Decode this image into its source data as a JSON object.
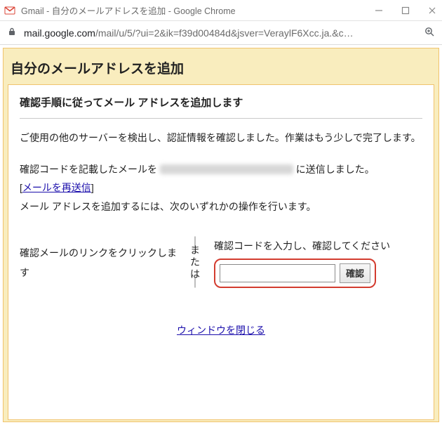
{
  "window": {
    "title": "Gmail - 自分のメールアドレスを追加 - Google Chrome"
  },
  "address": {
    "host": "mail.google.com",
    "path": "/mail/u/5/?ui=2&ik=f39d00484d&jsver=VeraylF6Xcc.ja.&c…"
  },
  "page": {
    "title": "自分のメールアドレスを追加",
    "heading": "確認手順に従ってメール アドレスを追加します",
    "para1": "ご使用の他のサーバーを検出し、認証情報を確認しました。作業はもう少しで完了します。",
    "sent_prefix": "確認コードを記載したメールを ",
    "sent_suffix": " に送信しました。",
    "resend_open": "[",
    "resend_label": "メールを再送信",
    "resend_close": "]",
    "instruction": "メール アドレスを追加するには、次のいずれかの操作を行います。",
    "left_option": "確認メールのリンクをクリックします",
    "or_bar": "｜",
    "or1": "ま",
    "or2": "た",
    "or3": "は",
    "right_prompt": "確認コードを入力し、確認してください",
    "verify_button": "確認",
    "close_window": "ウィンドウを閉じる"
  }
}
